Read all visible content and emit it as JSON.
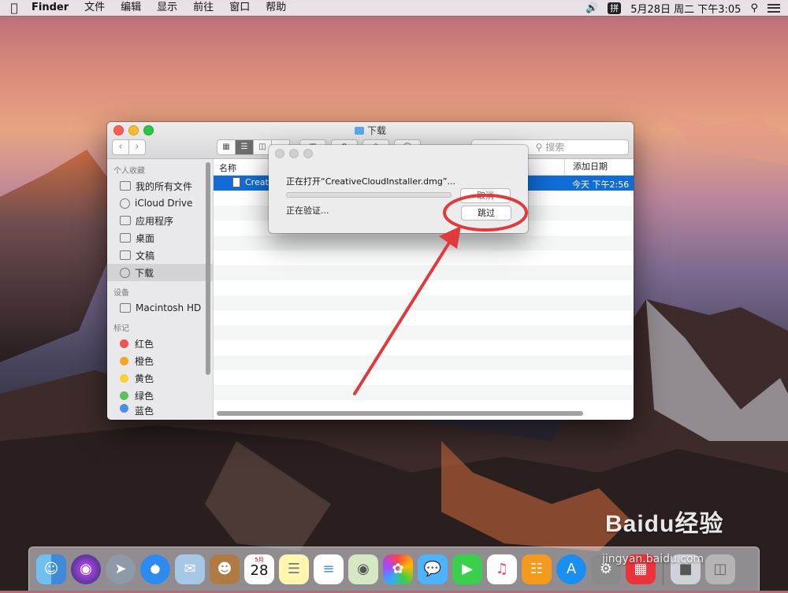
{
  "menubar": {
    "apple_icon": "",
    "items": [
      "Finder",
      "文件",
      "编辑",
      "显示",
      "前往",
      "窗口",
      "帮助"
    ],
    "ime": "拼",
    "clock": "5月28日 周二 下午3:05"
  },
  "finder": {
    "title": "下载",
    "search_placeholder": "搜索",
    "sidebar": {
      "favorites_header": "个人收藏",
      "favorites": [
        "我的所有文件",
        "iCloud Drive",
        "应用程序",
        "桌面",
        "文稿",
        "下载"
      ],
      "devices_header": "设备",
      "devices": [
        "Macintosh HD"
      ],
      "tags_header": "标记",
      "tags": [
        {
          "label": "红色",
          "color": "#f0524f"
        },
        {
          "label": "橙色",
          "color": "#f5a623"
        },
        {
          "label": "黄色",
          "color": "#f8d03a"
        },
        {
          "label": "绿色",
          "color": "#5ac05a"
        },
        {
          "label": "蓝色",
          "color": "#4a90e2"
        }
      ]
    },
    "columns": {
      "name": "名称",
      "date_added": "添加日期"
    },
    "selected_file": {
      "name": "Creati",
      "date_added": "今天 下午2:56"
    }
  },
  "dialog": {
    "title": "正在打开“CreativeCloudInstaller.dmg”...",
    "status": "正在验证...",
    "cancel_label": "取消",
    "skip_label": "跳过"
  },
  "dock": {
    "calendar_month": "5月",
    "calendar_day": "28"
  },
  "watermark": {
    "brand": "Baidu经验",
    "url": "jingyan.baidu.com"
  },
  "colors": {
    "accent": "#116cd6",
    "annotation": "#e03a3e"
  }
}
